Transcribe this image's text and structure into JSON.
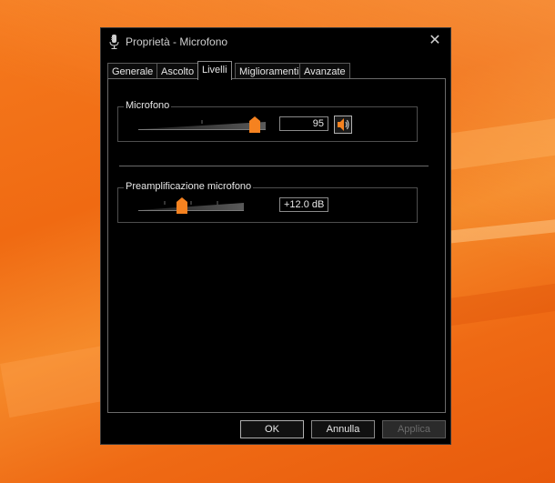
{
  "window": {
    "title": "Proprietà - Microfono",
    "icon": "microphone-icon",
    "close_glyph": "✕"
  },
  "tabs": [
    {
      "label": "Generale",
      "active": false
    },
    {
      "label": "Ascolto",
      "active": false
    },
    {
      "label": "Livelli",
      "active": true
    },
    {
      "label": "Miglioramenti",
      "active": false
    },
    {
      "label": "Avanzate",
      "active": false
    }
  ],
  "levels": {
    "microphone": {
      "label": "Microfono",
      "value": "95",
      "level_percent": 95,
      "mute_icon": "speaker-icon"
    },
    "boost": {
      "label": "Preamplificazione microfono",
      "value": "+12.0 dB",
      "level_percent": 40
    }
  },
  "buttons": {
    "ok": "OK",
    "cancel": "Annulla",
    "apply": "Applica"
  },
  "colors": {
    "accent": "#f58220",
    "background": "#000000",
    "text": "#e8e8e8"
  }
}
